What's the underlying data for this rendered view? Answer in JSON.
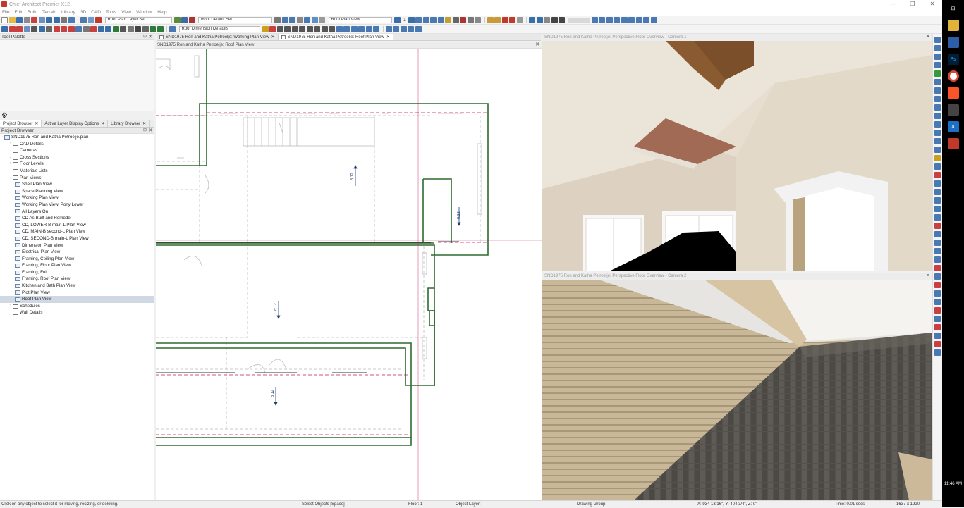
{
  "window": {
    "title": "Chief Architect Premier X12",
    "controls": [
      "—",
      "❐",
      "✕"
    ]
  },
  "menu": [
    "File",
    "Edit",
    "Build",
    "Terrain",
    "Library",
    "3D",
    "CAD",
    "Tools",
    "View",
    "Window",
    "Help"
  ],
  "toolbar": {
    "layer_set": "Roof Plan Layer Set",
    "default_set": "Roof Default Set",
    "plan_view": "Roof Plan View",
    "dimension_defaults": "Roof Dimension Defaults",
    "floor_number": "1"
  },
  "tool_palette": {
    "title": "Tool Palette"
  },
  "left_tabs": [
    {
      "label": "Project Browser",
      "active": true
    },
    {
      "label": "Active Layer Display Options",
      "active": false
    },
    {
      "label": "Library Browser",
      "active": false
    }
  ],
  "project_browser": {
    "title": "Project Browser",
    "root": "SND1975 Ron and Katha Petroelje.plan",
    "items": [
      {
        "label": "CAD Details",
        "level": 1,
        "arrow": "›"
      },
      {
        "label": "Cameras",
        "level": 1,
        "arrow": ""
      },
      {
        "label": "Cross Sections",
        "level": 1,
        "arrow": "›"
      },
      {
        "label": "Floor Levels",
        "level": 1,
        "arrow": "›"
      },
      {
        "label": "Materials Lists",
        "level": 1,
        "arrow": ""
      },
      {
        "label": "Plan Views",
        "level": 1,
        "arrow": "⌄"
      },
      {
        "label": "Shell Plan View",
        "level": 2,
        "arrow": ""
      },
      {
        "label": "Space Planning View",
        "level": 2,
        "arrow": ""
      },
      {
        "label": "Working Plan View",
        "level": 2,
        "arrow": ""
      },
      {
        "label": "Working Plan View, Pony Lower",
        "level": 2,
        "arrow": ""
      },
      {
        "label": "All Layers On",
        "level": 2,
        "arrow": ""
      },
      {
        "label": "CD As-Built and Remodel",
        "level": 2,
        "arrow": ""
      },
      {
        "label": "CD, LOWER-B main-L Plan View",
        "level": 2,
        "arrow": ""
      },
      {
        "label": "CD, MAIN-B second-L Plan View",
        "level": 2,
        "arrow": ""
      },
      {
        "label": "CD, SECOND-B main-L Plan View",
        "level": 2,
        "arrow": ""
      },
      {
        "label": "Dimension Plan View",
        "level": 2,
        "arrow": ""
      },
      {
        "label": "Electrical Plan View",
        "level": 2,
        "arrow": ""
      },
      {
        "label": "Framing, Ceiling Plan View",
        "level": 2,
        "arrow": ""
      },
      {
        "label": "Framing, Floor Plan View",
        "level": 2,
        "arrow": ""
      },
      {
        "label": "Framing, Full",
        "level": 2,
        "arrow": ""
      },
      {
        "label": "Framing, Roof Plan View",
        "level": 2,
        "arrow": ""
      },
      {
        "label": "Kitchen and Bath Plan View",
        "level": 2,
        "arrow": ""
      },
      {
        "label": "Plot Plan View",
        "level": 2,
        "arrow": ""
      },
      {
        "label": "Roof Plan View",
        "level": 2,
        "arrow": "",
        "selected": true
      },
      {
        "label": "Schedules",
        "level": 1,
        "arrow": "›"
      },
      {
        "label": "Wall Details",
        "level": 1,
        "arrow": ""
      }
    ]
  },
  "doc_tabs": [
    {
      "label": "SND1975 Ron and Katha Petroelje: Working Plan View",
      "active": false
    },
    {
      "label": "SND1975 Ron and Katha Petroelje: Roof Plan View",
      "active": true
    }
  ],
  "plan_view": {
    "title": "SND1975 Ron and Katha Petroelje: Roof Plan View",
    "pitch_labels": [
      "8:12",
      "8:12",
      "8:12",
      "8:12"
    ]
  },
  "camera1": {
    "title": "SND1975 Ron and Katha Petroelje: Perspective Floor Overview - Camera 1"
  },
  "camera2": {
    "title": "SND1975 Ron and Katha Petroelje: Perspective Floor Overview - Camera 2"
  },
  "status": {
    "hint": "Click on any object to select it for moving, resizing, or deleting.",
    "mode": "Select Objects [Space]",
    "floor": "Floor: 1",
    "object_layer": "Object Layer: -",
    "drawing_group": "Drawing Group: -",
    "coords": "X: 934 13/16\", Y: 404 3/4\", Z: 0\"",
    "time": "Time: 0.01 secs",
    "resolution": "1637 x 1920"
  },
  "taskbar": {
    "clock": "11:46 AM"
  },
  "colors": {
    "wall_green": "#2e6b2e",
    "ridge_red": "#c2185b",
    "selection_blue": "#cfd8e3"
  }
}
